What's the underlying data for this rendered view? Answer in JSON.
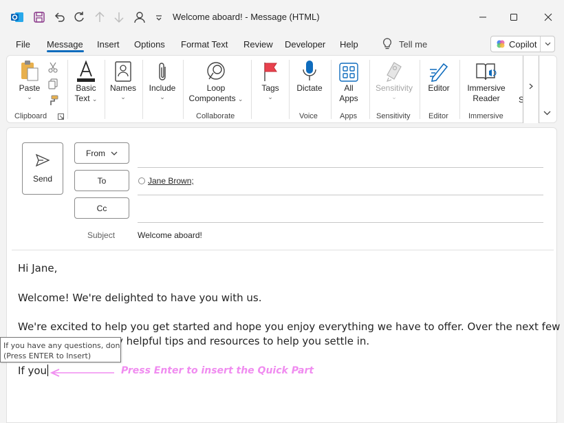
{
  "window": {
    "title": "Welcome aboard!  -  Message (HTML)"
  },
  "menu": {
    "tabs": [
      "File",
      "Message",
      "Insert",
      "Options",
      "Format Text",
      "Review",
      "Developer",
      "Help"
    ],
    "tell_me": "Tell me",
    "copilot": "Copilot"
  },
  "ribbon": {
    "paste": "Paste",
    "basic_text_1": "Basic",
    "basic_text_2": "Text",
    "names": "Names",
    "include": "Include",
    "loop_1": "Loop",
    "loop_2": "Components",
    "tags": "Tags",
    "dictate": "Dictate",
    "all_apps_1": "All",
    "all_apps_2": "Apps",
    "sensitivity": "Sensitivity",
    "editor": "Editor",
    "immersive_1": "Immersive",
    "immersive_2": "Reader",
    "partial": "S",
    "groups": {
      "clipboard": "Clipboard",
      "collaborate": "Collaborate",
      "voice": "Voice",
      "apps": "Apps",
      "sensitivity": "Sensitivity",
      "editor": "Editor",
      "immersive": "Immersive"
    }
  },
  "compose": {
    "send": "Send",
    "from": "From",
    "to": "To",
    "cc": "Cc",
    "to_recipient": "Jane Brown;",
    "subject_label": "Subject",
    "subject_value": "Welcome aboard!",
    "body": {
      "line1": "Hi Jane,",
      "line2": "Welcome! We're delighted to have you with us.",
      "line3": "We're excited to help you get started and hope you enjoy everything we have to offer. Over the next few days,",
      "line4": "y helpful tips and resources to help you settle in.",
      "line5": "If you"
    }
  },
  "tooltip": {
    "line1": "If you have any questions, don...",
    "line2": "(Press ENTER to Insert)"
  },
  "annotation": {
    "text": "Press Enter to insert the Quick Part",
    "color": "#f08cf0"
  },
  "colors": {
    "accent": "#0f6cbd",
    "outlook_blue": "#0078d4",
    "save_purple": "#a4373a",
    "tags_red": "#e8414d"
  }
}
